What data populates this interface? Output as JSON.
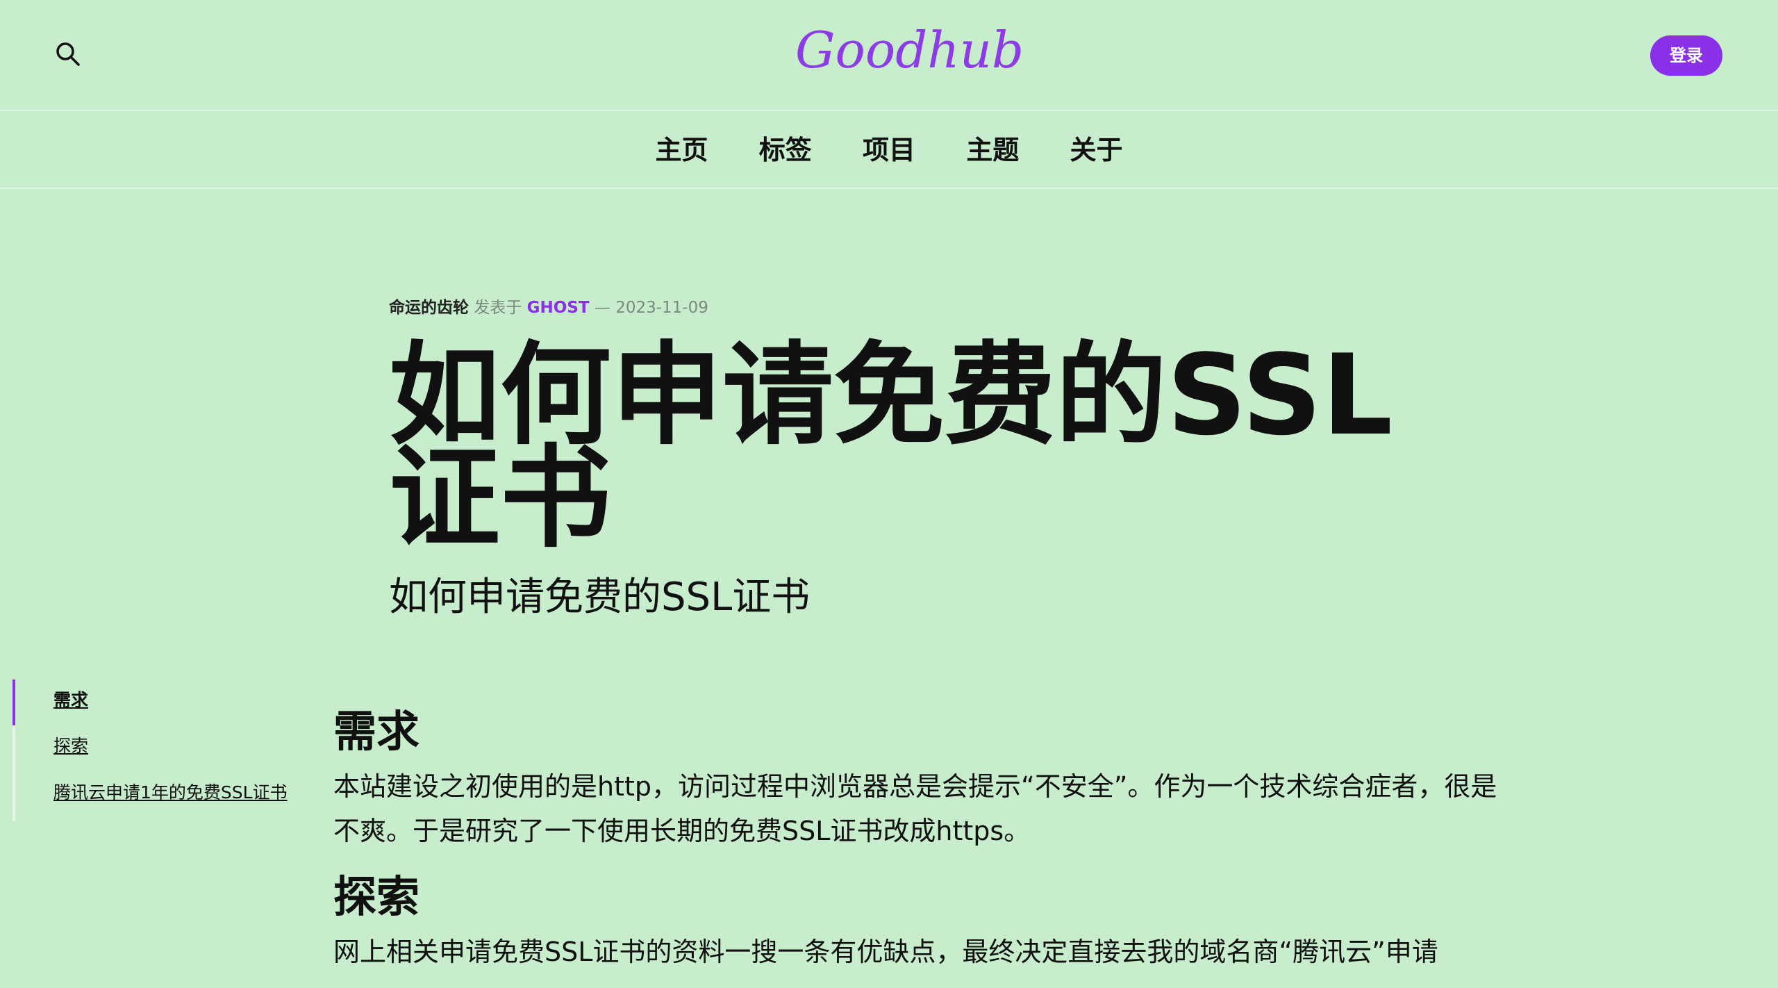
{
  "header": {
    "logo": "Goodhub",
    "login_label": "登录"
  },
  "nav": {
    "items": [
      "主页",
      "标签",
      "项目",
      "主题",
      "关于"
    ]
  },
  "post": {
    "author": "命运的齿轮",
    "published_in": "发表于",
    "tag": "GHOST",
    "separator": "—",
    "date": "2023-11-09",
    "title": "如何申请免费的SSL证书",
    "subtitle": "如何申请免费的SSL证书"
  },
  "toc": {
    "items": [
      "需求",
      "探索",
      "腾讯云申请1年的免费SSL证书"
    ]
  },
  "content": {
    "sections": [
      {
        "heading": "需求",
        "text": "本站建设之初使用的是http，访问过程中浏览器总是会提示“不安全”。作为一个技术综合症者，很是不爽。于是研究了一下使用长期的免费SSL证书改成https。"
      },
      {
        "heading": "探索",
        "text": "网上相关申请免费SSL证书的资料一搜一条有优缺点，最终决定直接去我的域名商“腾讯云”申请"
      }
    ]
  },
  "colors": {
    "background": "#c7edcc",
    "accent": "#8a30e8",
    "text": "#111111"
  },
  "icons": {
    "search": "search-icon"
  }
}
